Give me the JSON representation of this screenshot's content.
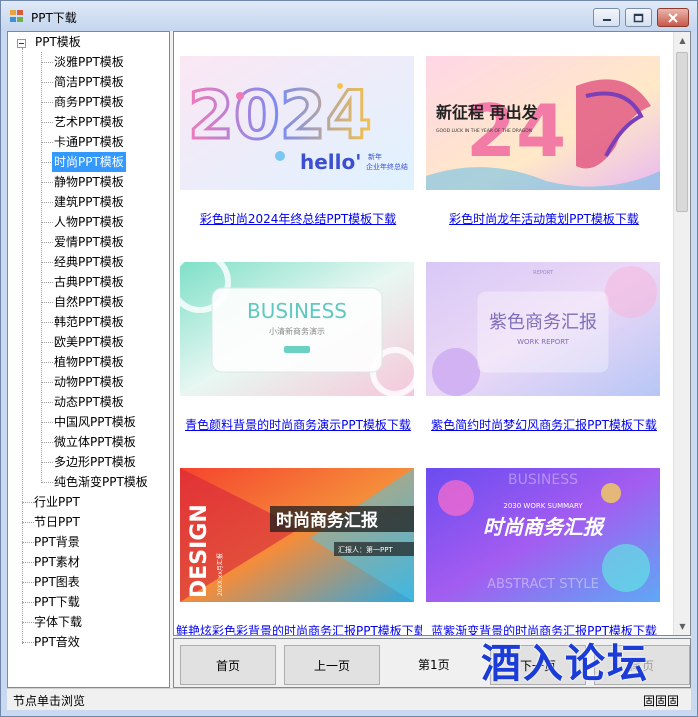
{
  "window": {
    "title": "PPT下载"
  },
  "tree": {
    "root_label": "PPT模板",
    "children": [
      "淡雅PPT模板",
      "简洁PPT模板",
      "商务PPT模板",
      "艺术PPT模板",
      "卡通PPT模板",
      "时尚PPT模板",
      "静物PPT模板",
      "建筑PPT模板",
      "人物PPT模板",
      "爱情PPT模板",
      "经典PPT模板",
      "古典PPT模板",
      "自然PPT模板",
      "韩范PPT模板",
      "欧美PPT模板",
      "植物PPT模板",
      "动物PPT模板",
      "动态PPT模板",
      "中国风PPT模板",
      "微立体PPT模板",
      "多边形PPT模板",
      "纯色渐变PPT模板"
    ],
    "selected": "时尚PPT模板",
    "top_level": [
      "行业PPT",
      "节日PPT",
      "PPT背景",
      "PPT素材",
      "PPT图表",
      "PPT下载",
      "字体下载",
      "PPT音效"
    ]
  },
  "gallery": {
    "items": [
      {
        "title": "彩色时尚2024年终总结PPT模板下载",
        "thumb_text": [
          "2024",
          "hello'",
          "新年",
          "企业年终总结"
        ]
      },
      {
        "title": "彩色时尚龙年活动策划PPT模板下载",
        "thumb_text": [
          "新征程 再出发",
          "2024",
          "GOOD LUCK IN THE YEAR OF THE DRAGON"
        ]
      },
      {
        "title": "青色颜料背景的时尚商务演示PPT模板下载",
        "thumb_text": [
          "BUSINESS",
          "小清新商务演示"
        ]
      },
      {
        "title": "紫色简约时尚梦幻风商务汇报PPT模板下载",
        "thumb_text": [
          "紫色商务汇报",
          "WORK REPORT",
          "REPORT"
        ]
      },
      {
        "title": "鲜艳炫彩色彩背景的时尚商务汇报PPT模板下载",
        "thumb_text": [
          "时尚商务汇报",
          "DESIGN",
          "汇报人：第一PPT",
          "20XX.xx月汇报"
        ]
      },
      {
        "title": "蓝紫渐变背景的时尚商务汇报PPT模板下载",
        "thumb_text": [
          "时尚商务汇报",
          "2030 WORK SUMMARY",
          "ABSTRACT STYLE",
          "BUSINESS"
        ]
      }
    ]
  },
  "pager": {
    "first": "首页",
    "prev": "上一页",
    "current": "第1页",
    "next": "下一页",
    "last": "尾页"
  },
  "status": {
    "text": "节点单击浏览",
    "right_text": "固固固"
  },
  "watermark": "酒入论坛",
  "colors": {
    "selection": "#3399ff",
    "link": "#0000ee",
    "window_frame": "#c9daf0"
  }
}
